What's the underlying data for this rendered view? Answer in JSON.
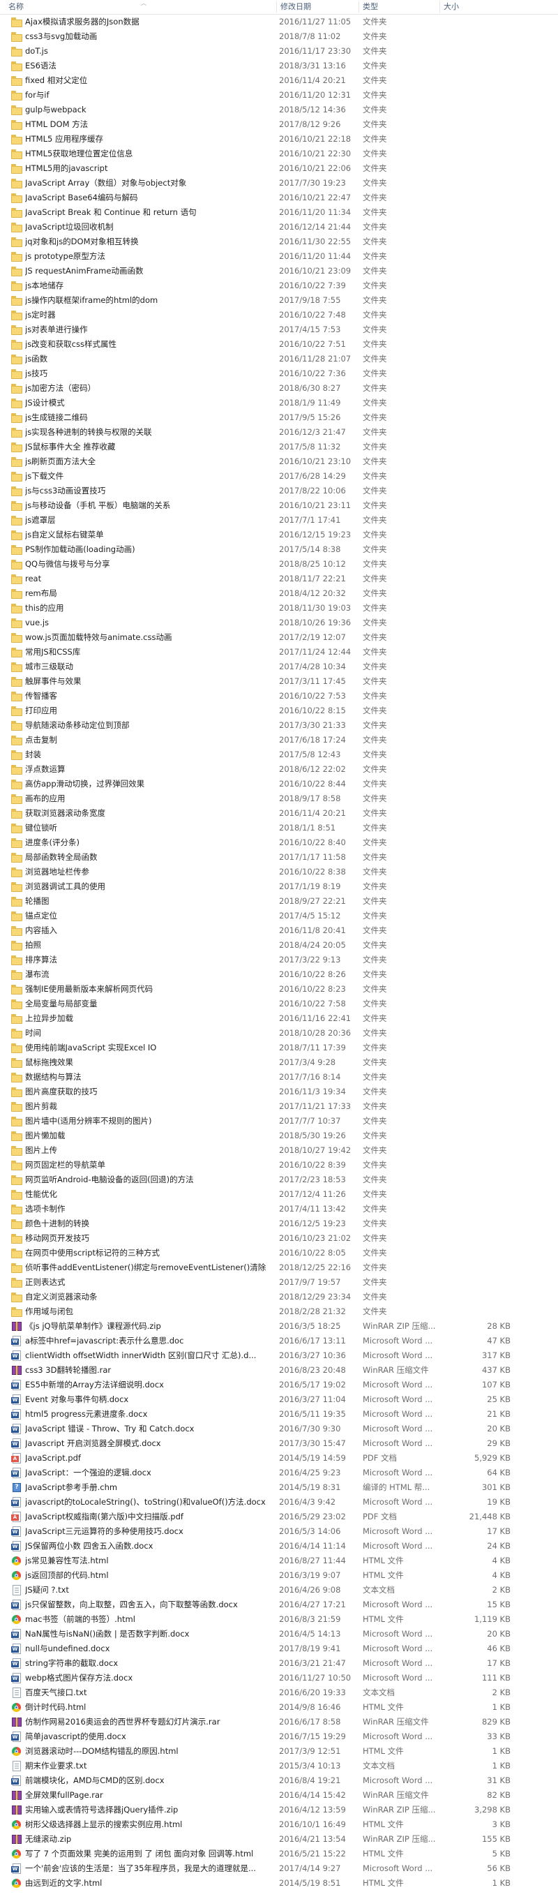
{
  "columns": {
    "name": "名称",
    "date": "修改日期",
    "type": "类型",
    "size": "大小"
  },
  "rows": [
    {
      "name": "Ajax模拟请求服务器的Json数据",
      "date": "2016/11/27 11:05",
      "type": "文件夹",
      "size": "",
      "icon": "folder-icon"
    },
    {
      "name": "css3与svg加载动画",
      "date": "2018/7/8 11:02",
      "type": "文件夹",
      "size": "",
      "icon": "folder-icon"
    },
    {
      "name": "doT.js",
      "date": "2016/11/17 23:30",
      "type": "文件夹",
      "size": "",
      "icon": "folder-icon"
    },
    {
      "name": "ES6语法",
      "date": "2018/3/31 13:16",
      "type": "文件夹",
      "size": "",
      "icon": "folder-icon"
    },
    {
      "name": "fixed 相对父定位",
      "date": "2016/11/4 20:21",
      "type": "文件夹",
      "size": "",
      "icon": "folder-icon"
    },
    {
      "name": "for与if",
      "date": "2016/11/20 12:31",
      "type": "文件夹",
      "size": "",
      "icon": "folder-icon"
    },
    {
      "name": "gulp与webpack",
      "date": "2018/5/12 14:36",
      "type": "文件夹",
      "size": "",
      "icon": "folder-icon"
    },
    {
      "name": "HTML DOM 方法",
      "date": "2017/8/12 9:26",
      "type": "文件夹",
      "size": "",
      "icon": "folder-icon"
    },
    {
      "name": "HTML5 应用程序缓存",
      "date": "2016/10/21 22:18",
      "type": "文件夹",
      "size": "",
      "icon": "folder-icon"
    },
    {
      "name": "HTML5获取地理位置定位信息",
      "date": "2016/10/21 22:30",
      "type": "文件夹",
      "size": "",
      "icon": "folder-icon"
    },
    {
      "name": "HTML5用的javascript",
      "date": "2016/10/21 22:06",
      "type": "文件夹",
      "size": "",
      "icon": "folder-icon"
    },
    {
      "name": "JavaScript Array（数组）对象与object对象",
      "date": "2017/7/30 19:23",
      "type": "文件夹",
      "size": "",
      "icon": "folder-icon"
    },
    {
      "name": "JavaScript Base64编码与解码",
      "date": "2016/10/21 22:47",
      "type": "文件夹",
      "size": "",
      "icon": "folder-icon"
    },
    {
      "name": "JavaScript Break 和 Continue 和 return 语句",
      "date": "2016/11/20 11:34",
      "type": "文件夹",
      "size": "",
      "icon": "folder-icon"
    },
    {
      "name": "JavaScript垃圾回收机制",
      "date": "2016/12/14 21:44",
      "type": "文件夹",
      "size": "",
      "icon": "folder-icon"
    },
    {
      "name": "jq对象和js的DOM对象相互转换",
      "date": "2016/11/30 22:55",
      "type": "文件夹",
      "size": "",
      "icon": "folder-icon"
    },
    {
      "name": "js prototype原型方法",
      "date": "2016/11/20 11:44",
      "type": "文件夹",
      "size": "",
      "icon": "folder-icon"
    },
    {
      "name": "JS requestAnimFrame动画函数",
      "date": "2016/10/21 23:09",
      "type": "文件夹",
      "size": "",
      "icon": "folder-icon"
    },
    {
      "name": "js本地储存",
      "date": "2016/10/22 7:39",
      "type": "文件夹",
      "size": "",
      "icon": "folder-icon"
    },
    {
      "name": "js操作内联框架iframe的html的dom",
      "date": "2017/9/18 7:55",
      "type": "文件夹",
      "size": "",
      "icon": "folder-icon"
    },
    {
      "name": "js定时器",
      "date": "2016/10/22 7:48",
      "type": "文件夹",
      "size": "",
      "icon": "folder-icon"
    },
    {
      "name": "js对表单进行操作",
      "date": "2017/4/15 7:53",
      "type": "文件夹",
      "size": "",
      "icon": "folder-icon"
    },
    {
      "name": "js改变和获取css样式属性",
      "date": "2016/10/22 7:51",
      "type": "文件夹",
      "size": "",
      "icon": "folder-icon"
    },
    {
      "name": "js函数",
      "date": "2016/11/28 21:07",
      "type": "文件夹",
      "size": "",
      "icon": "folder-icon"
    },
    {
      "name": "js技巧",
      "date": "2016/10/22 7:36",
      "type": "文件夹",
      "size": "",
      "icon": "folder-icon"
    },
    {
      "name": "js加密方法（密码）",
      "date": "2018/6/30 8:27",
      "type": "文件夹",
      "size": "",
      "icon": "folder-icon"
    },
    {
      "name": "JS设计模式",
      "date": "2018/1/9 11:49",
      "type": "文件夹",
      "size": "",
      "icon": "folder-icon"
    },
    {
      "name": "js生成链接二维码",
      "date": "2017/9/5 15:26",
      "type": "文件夹",
      "size": "",
      "icon": "folder-icon"
    },
    {
      "name": "js实现各种进制的转换与权限的关联",
      "date": "2016/12/3 21:47",
      "type": "文件夹",
      "size": "",
      "icon": "folder-icon"
    },
    {
      "name": "JS鼠标事件大全 推荐收藏",
      "date": "2017/5/8 11:32",
      "type": "文件夹",
      "size": "",
      "icon": "folder-icon"
    },
    {
      "name": "js刷新页面方法大全",
      "date": "2016/10/21 23:10",
      "type": "文件夹",
      "size": "",
      "icon": "folder-icon"
    },
    {
      "name": "js下载文件",
      "date": "2017/6/28 14:29",
      "type": "文件夹",
      "size": "",
      "icon": "folder-icon"
    },
    {
      "name": "js与css3动画设置技巧",
      "date": "2017/8/22 10:06",
      "type": "文件夹",
      "size": "",
      "icon": "folder-icon"
    },
    {
      "name": "js与移动设备（手机 平板）电脑端的关系",
      "date": "2016/10/21 23:11",
      "type": "文件夹",
      "size": "",
      "icon": "folder-icon"
    },
    {
      "name": "js遮罩层",
      "date": "2017/7/1 17:41",
      "type": "文件夹",
      "size": "",
      "icon": "folder-icon"
    },
    {
      "name": "js自定义鼠标右键菜单",
      "date": "2016/12/15 19:23",
      "type": "文件夹",
      "size": "",
      "icon": "folder-icon"
    },
    {
      "name": "PS制作加载动画(loading动画)",
      "date": "2017/5/14 8:38",
      "type": "文件夹",
      "size": "",
      "icon": "folder-icon"
    },
    {
      "name": "QQ与微信与拨号与分享",
      "date": "2018/8/25 10:12",
      "type": "文件夹",
      "size": "",
      "icon": "folder-icon"
    },
    {
      "name": "reat",
      "date": "2018/11/7 22:21",
      "type": "文件夹",
      "size": "",
      "icon": "folder-icon"
    },
    {
      "name": "rem布局",
      "date": "2018/4/12 20:32",
      "type": "文件夹",
      "size": "",
      "icon": "folder-icon"
    },
    {
      "name": "this的应用",
      "date": "2018/11/30 19:03",
      "type": "文件夹",
      "size": "",
      "icon": "folder-icon"
    },
    {
      "name": "vue.js",
      "date": "2018/10/26 19:36",
      "type": "文件夹",
      "size": "",
      "icon": "folder-icon"
    },
    {
      "name": "wow.js页面加载特效与animate.css动画",
      "date": "2017/2/19 12:07",
      "type": "文件夹",
      "size": "",
      "icon": "folder-icon"
    },
    {
      "name": "常用JS和CSS库",
      "date": "2017/11/24 12:44",
      "type": "文件夹",
      "size": "",
      "icon": "folder-icon"
    },
    {
      "name": "城市三级联动",
      "date": "2017/4/28 10:34",
      "type": "文件夹",
      "size": "",
      "icon": "folder-icon"
    },
    {
      "name": "触屏事件与效果",
      "date": "2017/3/11 17:45",
      "type": "文件夹",
      "size": "",
      "icon": "folder-icon"
    },
    {
      "name": "传智播客",
      "date": "2016/10/22 7:53",
      "type": "文件夹",
      "size": "",
      "icon": "folder-icon"
    },
    {
      "name": "打印应用",
      "date": "2016/10/22 8:15",
      "type": "文件夹",
      "size": "",
      "icon": "folder-icon"
    },
    {
      "name": "导航随滚动条移动定位到顶部",
      "date": "2017/3/30 21:33",
      "type": "文件夹",
      "size": "",
      "icon": "folder-icon"
    },
    {
      "name": "点击复制",
      "date": "2017/6/18 17:24",
      "type": "文件夹",
      "size": "",
      "icon": "folder-icon"
    },
    {
      "name": "封装",
      "date": "2017/5/8 12:43",
      "type": "文件夹",
      "size": "",
      "icon": "folder-icon"
    },
    {
      "name": "浮点数运算",
      "date": "2018/6/12 22:02",
      "type": "文件夹",
      "size": "",
      "icon": "folder-icon"
    },
    {
      "name": "高仿app滑动切换，过界弹回效果",
      "date": "2016/10/22 8:44",
      "type": "文件夹",
      "size": "",
      "icon": "folder-icon"
    },
    {
      "name": "画布的应用",
      "date": "2018/9/17 8:58",
      "type": "文件夹",
      "size": "",
      "icon": "folder-icon"
    },
    {
      "name": "获取浏览器滚动条宽度",
      "date": "2016/11/4 20:21",
      "type": "文件夹",
      "size": "",
      "icon": "folder-icon"
    },
    {
      "name": "键位锁听",
      "date": "2018/1/1 8:51",
      "type": "文件夹",
      "size": "",
      "icon": "folder-icon"
    },
    {
      "name": "进度条(评分条)",
      "date": "2016/10/22 8:40",
      "type": "文件夹",
      "size": "",
      "icon": "folder-icon"
    },
    {
      "name": "局部函数转全局函数",
      "date": "2017/1/17 11:58",
      "type": "文件夹",
      "size": "",
      "icon": "folder-icon"
    },
    {
      "name": "浏览器地址栏传参",
      "date": "2016/10/22 8:38",
      "type": "文件夹",
      "size": "",
      "icon": "folder-icon"
    },
    {
      "name": "浏览器调试工具的使用",
      "date": "2017/1/19 8:19",
      "type": "文件夹",
      "size": "",
      "icon": "folder-icon"
    },
    {
      "name": "轮播图",
      "date": "2018/9/27 22:21",
      "type": "文件夹",
      "size": "",
      "icon": "folder-icon"
    },
    {
      "name": "锚点定位",
      "date": "2017/4/5 15:12",
      "type": "文件夹",
      "size": "",
      "icon": "folder-icon"
    },
    {
      "name": "内容插入",
      "date": "2016/11/8 20:41",
      "type": "文件夹",
      "size": "",
      "icon": "folder-icon"
    },
    {
      "name": "拍照",
      "date": "2018/4/24 20:05",
      "type": "文件夹",
      "size": "",
      "icon": "folder-icon"
    },
    {
      "name": "排序算法",
      "date": "2017/3/22 9:13",
      "type": "文件夹",
      "size": "",
      "icon": "folder-icon"
    },
    {
      "name": "瀑布流",
      "date": "2016/10/22 8:26",
      "type": "文件夹",
      "size": "",
      "icon": "folder-icon"
    },
    {
      "name": "强制IE使用最新版本来解析网页代码",
      "date": "2016/10/22 8:23",
      "type": "文件夹",
      "size": "",
      "icon": "folder-icon"
    },
    {
      "name": "全局变量与局部变量",
      "date": "2016/10/22 7:58",
      "type": "文件夹",
      "size": "",
      "icon": "folder-icon"
    },
    {
      "name": "上拉异步加载",
      "date": "2016/11/16 22:41",
      "type": "文件夹",
      "size": "",
      "icon": "folder-icon"
    },
    {
      "name": "时间",
      "date": "2018/10/28 20:36",
      "type": "文件夹",
      "size": "",
      "icon": "folder-icon"
    },
    {
      "name": "使用纯前端JavaScript 实现Excel IO",
      "date": "2018/7/11 17:39",
      "type": "文件夹",
      "size": "",
      "icon": "folder-icon"
    },
    {
      "name": "鼠标拖拽效果",
      "date": "2017/3/4 9:28",
      "type": "文件夹",
      "size": "",
      "icon": "folder-icon"
    },
    {
      "name": "数据结构与算法",
      "date": "2017/7/16 8:14",
      "type": "文件夹",
      "size": "",
      "icon": "folder-icon"
    },
    {
      "name": "图片高度获取的技巧",
      "date": "2016/11/3 19:34",
      "type": "文件夹",
      "size": "",
      "icon": "folder-icon"
    },
    {
      "name": "图片剪裁",
      "date": "2017/11/21 17:33",
      "type": "文件夹",
      "size": "",
      "icon": "folder-icon"
    },
    {
      "name": "图片墙中(适用分辨率不规则的图片)",
      "date": "2017/7/7 10:37",
      "type": "文件夹",
      "size": "",
      "icon": "folder-icon"
    },
    {
      "name": "图片懒加载",
      "date": "2018/5/30 19:26",
      "type": "文件夹",
      "size": "",
      "icon": "folder-icon"
    },
    {
      "name": "图片上传",
      "date": "2018/10/27 19:42",
      "type": "文件夹",
      "size": "",
      "icon": "folder-icon"
    },
    {
      "name": "网页固定栏的导航菜单",
      "date": "2016/10/22 8:39",
      "type": "文件夹",
      "size": "",
      "icon": "folder-icon"
    },
    {
      "name": "网页监听Android-电脑设备的返回(回退)的方法",
      "date": "2017/2/23 18:53",
      "type": "文件夹",
      "size": "",
      "icon": "folder-icon"
    },
    {
      "name": "性能优化",
      "date": "2017/12/4 11:26",
      "type": "文件夹",
      "size": "",
      "icon": "folder-icon"
    },
    {
      "name": "选项卡制作",
      "date": "2017/4/11 13:42",
      "type": "文件夹",
      "size": "",
      "icon": "folder-icon"
    },
    {
      "name": "颜色十进制的转换",
      "date": "2016/12/5 19:23",
      "type": "文件夹",
      "size": "",
      "icon": "folder-icon"
    },
    {
      "name": "移动网页开发技巧",
      "date": "2016/10/23 21:02",
      "type": "文件夹",
      "size": "",
      "icon": "folder-icon"
    },
    {
      "name": "在网页中使用script标记符的三种方式",
      "date": "2016/10/22 8:05",
      "type": "文件夹",
      "size": "",
      "icon": "folder-icon"
    },
    {
      "name": "侦听事件addEventListener()绑定与removeEventListener()清除",
      "date": "2018/12/25 22:16",
      "type": "文件夹",
      "size": "",
      "icon": "folder-icon"
    },
    {
      "name": "正则表达式",
      "date": "2017/9/7 19:57",
      "type": "文件夹",
      "size": "",
      "icon": "folder-icon"
    },
    {
      "name": "自定义浏览器滚动条",
      "date": "2018/12/29 23:34",
      "type": "文件夹",
      "size": "",
      "icon": "folder-icon"
    },
    {
      "name": "作用域与闭包",
      "date": "2018/2/28 21:32",
      "type": "文件夹",
      "size": "",
      "icon": "folder-icon"
    },
    {
      "name": "《js jQ导航菜单制作》课程源代码.zip",
      "date": "2016/3/5 18:25",
      "type": "WinRAR ZIP 压缩...",
      "size": "28 KB",
      "icon": "zip-archive-icon"
    },
    {
      "name": "a标签中href=javascript:表示什么意思.doc",
      "date": "2016/6/17 13:11",
      "type": "Microsoft Word ...",
      "size": "47 KB",
      "icon": "word-document-icon"
    },
    {
      "name": "clientWidth offsetWidth innerWidth 区别(窗口尺寸 汇总).d...",
      "date": "2016/3/27 10:36",
      "type": "Microsoft Word ...",
      "size": "317 KB",
      "icon": "word-document-icon"
    },
    {
      "name": "css3 3D翻转轮播图.rar",
      "date": "2016/8/23 20:48",
      "type": "WinRAR 压缩文件",
      "size": "437 KB",
      "icon": "rar-archive-icon"
    },
    {
      "name": "ES5中新增的Array方法详细说明.docx",
      "date": "2016/5/17 19:02",
      "type": "Microsoft Word ...",
      "size": "107 KB",
      "icon": "word-document-icon"
    },
    {
      "name": "Event 对象与事件句柄.docx",
      "date": "2016/3/27 11:04",
      "type": "Microsoft Word ...",
      "size": "25 KB",
      "icon": "word-document-icon"
    },
    {
      "name": "html5 progress元素进度条.docx",
      "date": "2016/5/11 19:35",
      "type": "Microsoft Word ...",
      "size": "21 KB",
      "icon": "word-document-icon"
    },
    {
      "name": "JavaScript 错误 - Throw、Try 和 Catch.docx",
      "date": "2016/7/30 9:30",
      "type": "Microsoft Word ...",
      "size": "20 KB",
      "icon": "word-document-icon"
    },
    {
      "name": "Javascript 开启浏览器全屏模式.docx",
      "date": "2017/3/30 15:47",
      "type": "Microsoft Word ...",
      "size": "29 KB",
      "icon": "word-document-icon"
    },
    {
      "name": "JavaScript.pdf",
      "date": "2014/5/19 14:59",
      "type": "PDF 文档",
      "size": "5,929 KB",
      "icon": "pdf-document-icon"
    },
    {
      "name": "JavaScript：一个强迫的逻辑.docx",
      "date": "2016/4/25 9:23",
      "type": "Microsoft Word ...",
      "size": "64 KB",
      "icon": "word-document-icon"
    },
    {
      "name": "JavaScript参考手册.chm",
      "date": "2014/5/19 8:31",
      "type": "编译的 HTML 帮...",
      "size": "301 KB",
      "icon": "chm-help-icon"
    },
    {
      "name": "javascript的toLocaleString()、toString()和valueOf()方法.docx",
      "date": "2016/4/3 9:42",
      "type": "Microsoft Word ...",
      "size": "19 KB",
      "icon": "word-document-icon"
    },
    {
      "name": "JavaScript权威指南(第六版)中文扫描版.pdf",
      "date": "2016/5/29 23:02",
      "type": "PDF 文档",
      "size": "21,448 KB",
      "icon": "pdf-document-icon"
    },
    {
      "name": "JavaScript三元运算符的多种使用技巧.docx",
      "date": "2016/5/3 14:06",
      "type": "Microsoft Word ...",
      "size": "17 KB",
      "icon": "word-document-icon"
    },
    {
      "name": "JS保留两位小数 四舍五入函数.docx",
      "date": "2016/4/14 11:14",
      "type": "Microsoft Word ...",
      "size": "24 KB",
      "icon": "word-document-icon"
    },
    {
      "name": "js常见兼容性写法.html",
      "date": "2016/8/27 11:44",
      "type": "HTML 文件",
      "size": "4 KB",
      "icon": "html-file-icon"
    },
    {
      "name": "js返回顶部的代码.html",
      "date": "2016/3/19 9:07",
      "type": "HTML 文件",
      "size": "4 KB",
      "icon": "html-file-icon"
    },
    {
      "name": "JS疑问 ?.txt",
      "date": "2016/4/26 9:08",
      "type": "文本文档",
      "size": "2 KB",
      "icon": "text-file-icon"
    },
    {
      "name": "js只保留整数，向上取整，四舍五入，向下取整等函数.docx",
      "date": "2016/4/27 17:21",
      "type": "Microsoft Word ...",
      "size": "15 KB",
      "icon": "word-document-icon"
    },
    {
      "name": "mac书签（前端的书签）.html",
      "date": "2016/8/3 21:59",
      "type": "HTML 文件",
      "size": "1,119 KB",
      "icon": "html-file-icon"
    },
    {
      "name": "NaN属性与isNaN()函数 | 是否数字判断.docx",
      "date": "2016/4/5 14:13",
      "type": "Microsoft Word ...",
      "size": "20 KB",
      "icon": "word-document-icon"
    },
    {
      "name": "null与undefined.docx",
      "date": "2017/8/19 9:41",
      "type": "Microsoft Word ...",
      "size": "46 KB",
      "icon": "word-document-icon"
    },
    {
      "name": "string字符串的截取.docx",
      "date": "2016/3/21 21:47",
      "type": "Microsoft Word ...",
      "size": "17 KB",
      "icon": "word-document-icon"
    },
    {
      "name": "webp格式图片保存方法.docx",
      "date": "2016/11/27 10:50",
      "type": "Microsoft Word ...",
      "size": "111 KB",
      "icon": "word-document-icon"
    },
    {
      "name": "百度天气接口.txt",
      "date": "2016/6/20 19:33",
      "type": "文本文档",
      "size": "2 KB",
      "icon": "text-file-icon"
    },
    {
      "name": "倒计时代码.html",
      "date": "2014/9/8 16:46",
      "type": "HTML 文件",
      "size": "1 KB",
      "icon": "html-file-icon"
    },
    {
      "name": "仿制作网易2016奥运会的西世界杯专题幻灯片演示.rar",
      "date": "2016/6/17 8:58",
      "type": "WinRAR 压缩文件",
      "size": "829 KB",
      "icon": "rar-archive-icon"
    },
    {
      "name": "简单javascript的使用.docx",
      "date": "2016/7/15 19:29",
      "type": "Microsoft Word ...",
      "size": "33 KB",
      "icon": "word-document-icon"
    },
    {
      "name": "浏览器滚动时---DOM结构错乱的原因.html",
      "date": "2017/3/9 12:51",
      "type": "HTML 文件",
      "size": "1 KB",
      "icon": "html-file-icon"
    },
    {
      "name": "期末作业要求.txt",
      "date": "2015/3/4 10:13",
      "type": "文本文档",
      "size": "1 KB",
      "icon": "text-file-icon"
    },
    {
      "name": "前端模块化，AMD与CMD的区别.docx",
      "date": "2016/8/4 19:21",
      "type": "Microsoft Word ...",
      "size": "31 KB",
      "icon": "word-document-icon"
    },
    {
      "name": "全屏效果fullPage.rar",
      "date": "2016/4/14 15:42",
      "type": "WinRAR 压缩文件",
      "size": "82 KB",
      "icon": "rar-archive-icon"
    },
    {
      "name": "实用输入或表情符号选择器jQuery插件.zip",
      "date": "2016/4/12 13:59",
      "type": "WinRAR ZIP 压缩...",
      "size": "3,298 KB",
      "icon": "zip-archive-icon"
    },
    {
      "name": "树形父级选择器上显示的搜索实例应用.html",
      "date": "2016/10/1 16:49",
      "type": "HTML 文件",
      "size": "3 KB",
      "icon": "html-file-icon"
    },
    {
      "name": "无缝滚动.zip",
      "date": "2016/4/21 13:54",
      "type": "WinRAR ZIP 压缩...",
      "size": "155 KB",
      "icon": "zip-archive-icon"
    },
    {
      "name": "写了 7 个页面效果  完美的运用到  了  闭包  面向对象  回调等.html",
      "date": "2016/5/21 15:22",
      "type": "HTML 文件",
      "size": "5 KB",
      "icon": "html-file-icon"
    },
    {
      "name": "一个'前会'应该的生活是：当了35年程序员，我是大的道理就是...",
      "date": "2017/4/14 9:27",
      "type": "Microsoft Word ...",
      "size": "56 KB",
      "icon": "word-document-icon"
    },
    {
      "name": "由远到近的文字.html",
      "date": "2014/5/19 8:51",
      "type": "HTML 文件",
      "size": "1 KB",
      "icon": "html-file-icon"
    }
  ]
}
